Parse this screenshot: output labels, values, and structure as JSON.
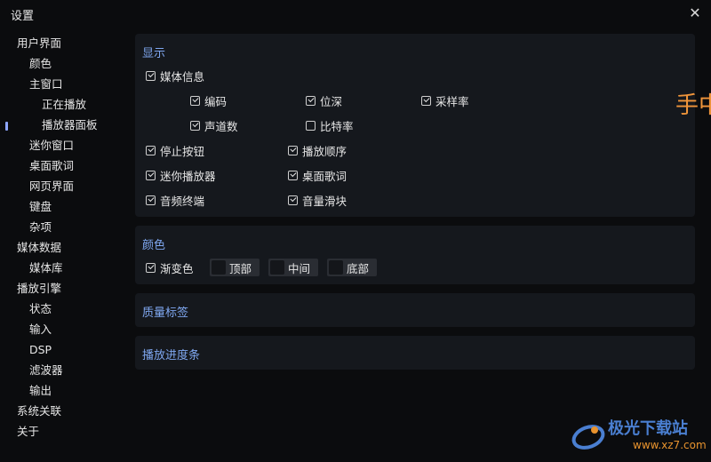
{
  "window": {
    "title": "设置",
    "close_glyph": "✕"
  },
  "sidebar": {
    "items": [
      {
        "label": "用户界面"
      },
      {
        "label": "颜色"
      },
      {
        "label": "主窗口"
      },
      {
        "label": "正在播放"
      },
      {
        "label": "播放器面板"
      },
      {
        "label": "迷你窗口"
      },
      {
        "label": "桌面歌词"
      },
      {
        "label": "网页界面"
      },
      {
        "label": "键盘"
      },
      {
        "label": "杂项"
      },
      {
        "label": "媒体数据"
      },
      {
        "label": "媒体库"
      },
      {
        "label": "播放引擎"
      },
      {
        "label": "状态"
      },
      {
        "label": "输入"
      },
      {
        "label": "DSP"
      },
      {
        "label": "滤波器"
      },
      {
        "label": "输出"
      },
      {
        "label": "系统关联"
      },
      {
        "label": "关于"
      }
    ],
    "selected": "播放器面板"
  },
  "display": {
    "title": "显示",
    "media_info": {
      "label": "媒体信息",
      "checked": true
    },
    "codec": {
      "label": "编码",
      "checked": true
    },
    "bit_depth": {
      "label": "位深",
      "checked": true
    },
    "sample_rate": {
      "label": "采样率",
      "checked": true
    },
    "channels": {
      "label": "声道数",
      "checked": true
    },
    "bitrate": {
      "label": "比特率",
      "checked": false
    },
    "stop_button": {
      "label": "停止按钮",
      "checked": true
    },
    "play_order": {
      "label": "播放顺序",
      "checked": true
    },
    "mini_player": {
      "label": "迷你播放器",
      "checked": true
    },
    "desktop_lyrics": {
      "label": "桌面歌词",
      "checked": true
    },
    "spectrum": {
      "label": "音频终端",
      "checked": true
    },
    "volume_slider": {
      "label": "音量滑块",
      "checked": true
    }
  },
  "colors": {
    "title": "颜色",
    "gradient": {
      "label": "渐变色",
      "checked": true
    },
    "top": {
      "label": "顶部"
    },
    "middle": {
      "label": "中间"
    },
    "bottom": {
      "label": "底部"
    }
  },
  "quality_tag": {
    "title": "质量标签"
  },
  "progress_bar": {
    "title": "播放进度条"
  },
  "side_text": "手中",
  "watermark": {
    "name": "极光下载站",
    "url": "www.xz7.com"
  }
}
